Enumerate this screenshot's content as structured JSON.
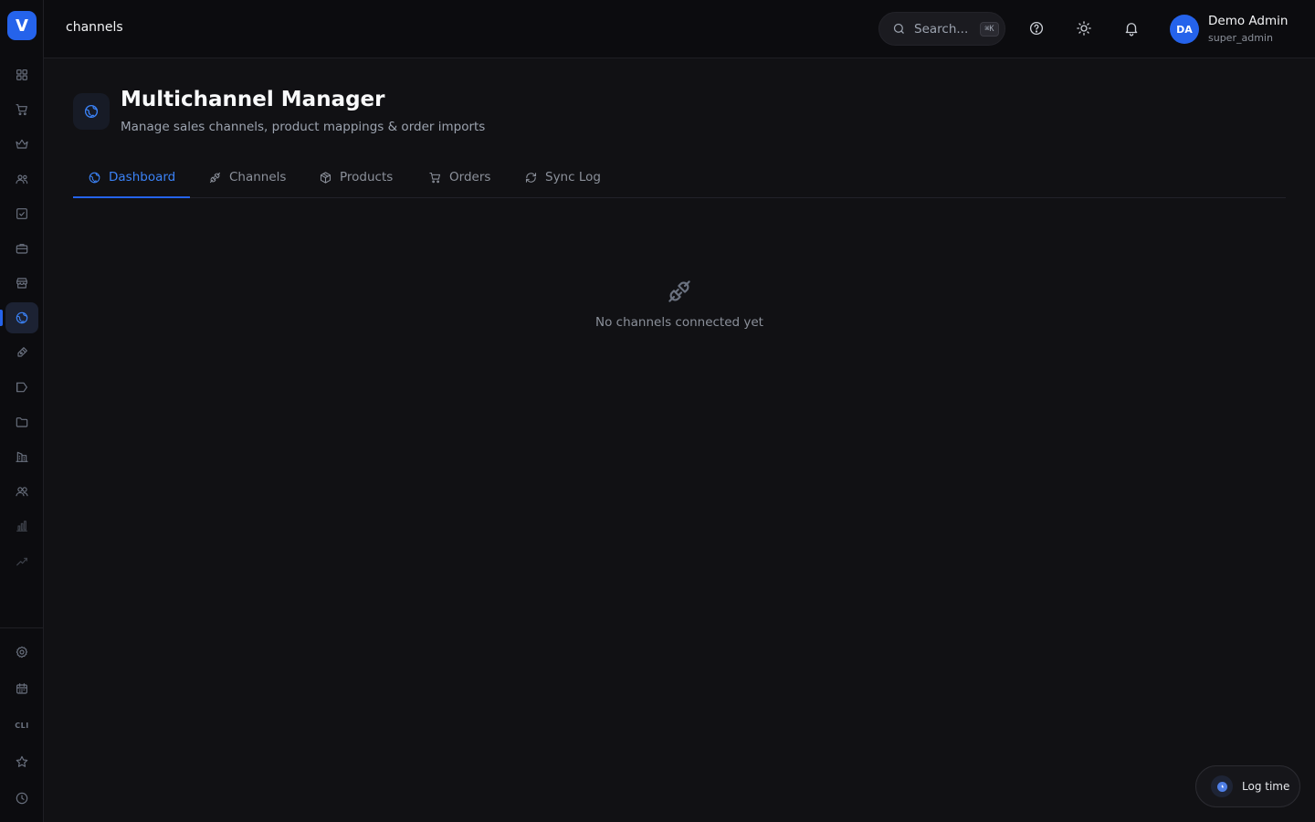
{
  "app": {
    "logo_letter": "V",
    "accent_color": "#2563eb"
  },
  "header": {
    "title": "channels",
    "search": {
      "placeholder": "Search...",
      "shortcut": "⌘K"
    },
    "icons": [
      "help-icon",
      "sun-icon",
      "bell-icon"
    ],
    "user": {
      "initials": "DA",
      "name": "Demo Admin",
      "role": "super_admin"
    }
  },
  "sidebar": {
    "items": [
      {
        "icon": "dashboard-grid-icon"
      },
      {
        "icon": "cart-icon"
      },
      {
        "icon": "crown-icon"
      },
      {
        "icon": "users-icon"
      },
      {
        "icon": "checkbox-icon"
      },
      {
        "icon": "briefcase-icon"
      },
      {
        "icon": "store-icon"
      },
      {
        "icon": "globe-icon",
        "active": true
      },
      {
        "icon": "pen-icon"
      },
      {
        "icon": "megaphone-icon"
      },
      {
        "icon": "folder-icon"
      },
      {
        "icon": "building-icon"
      },
      {
        "icon": "team-icon"
      },
      {
        "icon": "bar-chart-icon"
      },
      {
        "icon": "trend-icon"
      }
    ],
    "bottom_items": [
      {
        "icon": "settings-icon"
      },
      {
        "icon": "calendar-icon"
      },
      {
        "label": "CLI"
      },
      {
        "icon": "star-icon"
      },
      {
        "icon": "clock-icon"
      }
    ]
  },
  "page": {
    "title": "Multichannel Manager",
    "subtitle": "Manage sales channels, product mappings & order imports",
    "tabs": [
      {
        "label": "Dashboard",
        "icon": "globe-icon",
        "active": true
      },
      {
        "label": "Channels",
        "icon": "plug-icon"
      },
      {
        "label": "Products",
        "icon": "box-icon"
      },
      {
        "label": "Orders",
        "icon": "cart-icon"
      },
      {
        "label": "Sync Log",
        "icon": "refresh-icon"
      }
    ],
    "empty_state": {
      "icon": "plug-icon",
      "message": "No channels connected yet"
    }
  },
  "floating": {
    "log_time_label": "Log time"
  }
}
